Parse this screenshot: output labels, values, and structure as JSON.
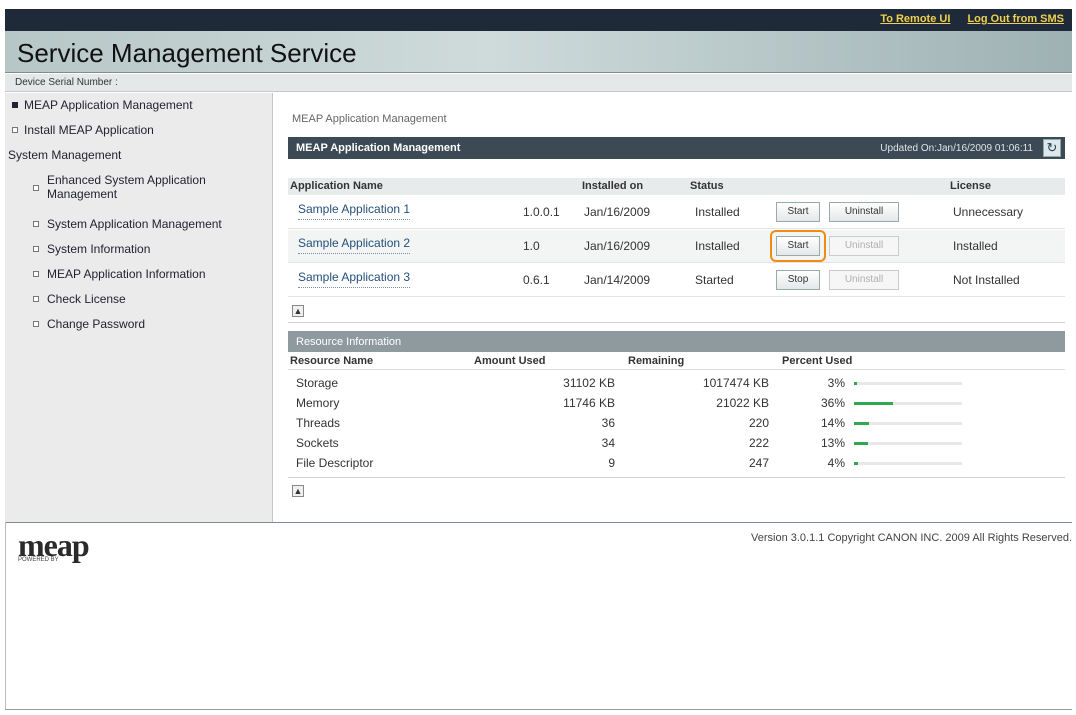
{
  "top_links": {
    "remote_ui": "To Remote UI",
    "logout": "Log Out from SMS"
  },
  "header": {
    "title": "Service Management Service",
    "serial_label": "Device Serial Number :"
  },
  "sidebar": {
    "items": [
      {
        "label": "MEAP Application Management",
        "active": true
      },
      {
        "label": "Install MEAP Application"
      },
      {
        "label": "System Management"
      },
      {
        "label": "Enhanced System Application Management"
      },
      {
        "label": "System Application Management"
      },
      {
        "label": "System Information"
      },
      {
        "label": "MEAP Application Information"
      },
      {
        "label": "Check License"
      },
      {
        "label": "Change Password"
      }
    ]
  },
  "main": {
    "breadcrumb": "MEAP Application Management",
    "panel_title": "MEAP Application Management",
    "updated": "Updated On:Jan/16/2009 01:06:11",
    "refresh_icon": "refresh-icon",
    "columns": [
      "Application Name",
      "Installed on",
      "Status",
      "License"
    ],
    "apps": [
      {
        "name": "Sample Application 1",
        "version": "1.0.0.1",
        "installed_on": "Jan/16/2009",
        "status": "Installed",
        "action": "Start",
        "uninstall": "Uninstall",
        "license": "Unnecessary"
      },
      {
        "name": "Sample Application 2",
        "version": "1.0",
        "installed_on": "Jan/16/2009",
        "status": "Installed",
        "action": "Start",
        "uninstall": "Uninstall",
        "license": "Installed"
      },
      {
        "name": "Sample Application 3",
        "version": "0.6.1",
        "installed_on": "Jan/14/2009",
        "status": "Started",
        "action": "Stop",
        "uninstall": "Uninstall",
        "license": "Not Installed"
      }
    ],
    "resource_title": "Resource Information",
    "resource_columns": [
      "Resource Name",
      "Amount Used",
      "Remaining",
      "Percent Used"
    ],
    "resources": [
      {
        "name": "Storage",
        "used": "31102 KB",
        "remaining": "1017474 KB",
        "percent": "3%",
        "fraction": 0.03
      },
      {
        "name": "Memory",
        "used": "11746 KB",
        "remaining": "21022 KB",
        "percent": "36%",
        "fraction": 0.36
      },
      {
        "name": "Threads",
        "used": "36",
        "remaining": "220",
        "percent": "14%",
        "fraction": 0.14
      },
      {
        "name": "Sockets",
        "used": "34",
        "remaining": "222",
        "percent": "13%",
        "fraction": 0.13
      },
      {
        "name": "File Descriptor",
        "used": "9",
        "remaining": "247",
        "percent": "4%",
        "fraction": 0.04
      }
    ]
  },
  "footer": {
    "logo_text": "meap",
    "logo_sub": "POWERED BY",
    "copyright": "Version 3.0.1.1 Copyright CANON INC. 2009 All Rights Reserved."
  },
  "colors": {
    "accent_highlight": "#f08c14",
    "bar_green": "#2fa84f",
    "link_yellow": "#f0d050"
  }
}
